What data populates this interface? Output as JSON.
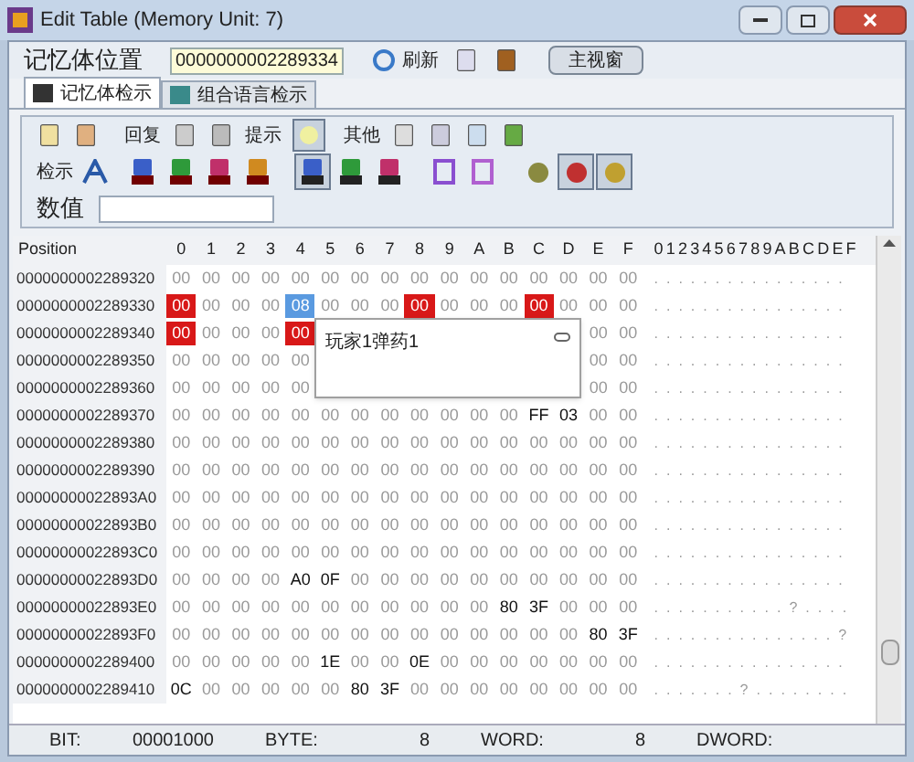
{
  "window": {
    "title": "Edit Table (Memory Unit: 7)"
  },
  "address_bar": {
    "label": "记忆体位置",
    "value": "0000000002289334",
    "refresh": "刷新",
    "main_button": "主视窗"
  },
  "tabs": [
    {
      "label": "记忆体检示",
      "selected": true
    },
    {
      "label": "组合语言检示",
      "selected": false
    }
  ],
  "toolbar": {
    "restore": "回复",
    "hint": "提示",
    "hint_pressed": true,
    "other": "其他",
    "view": "检示",
    "view_buttons": [
      {
        "kind": "dec",
        "color": "#3a5fc8",
        "pressed": false
      },
      {
        "kind": "dec",
        "color": "#2e9a3a",
        "pressed": false
      },
      {
        "kind": "dec",
        "color": "#c0306a",
        "pressed": false
      },
      {
        "kind": "dec",
        "color": "#d08a20",
        "pressed": false
      },
      {
        "kind": "hex",
        "color": "#3a5fc8",
        "pressed": true
      },
      {
        "kind": "hex",
        "color": "#2e9a3a",
        "pressed": false
      },
      {
        "kind": "hex",
        "color": "#c0306a",
        "pressed": false
      },
      {
        "kind": "page",
        "color": "#8a4fd0",
        "pressed": false
      },
      {
        "kind": "page",
        "color": "#b060d0",
        "pressed": false
      },
      {
        "kind": "ball",
        "color": "#8a8a40",
        "pressed": false
      },
      {
        "kind": "ball",
        "color": "#c03030",
        "pressed": true
      },
      {
        "kind": "ball",
        "color": "#c0a030",
        "pressed": true
      }
    ],
    "value_label": "数值"
  },
  "table": {
    "position_header": "Position",
    "columns": [
      "0",
      "1",
      "2",
      "3",
      "4",
      "5",
      "6",
      "7",
      "8",
      "9",
      "A",
      "B",
      "C",
      "D",
      "E",
      "F"
    ],
    "ascii_header": "0123456789ABCDEF",
    "rows": [
      {
        "address": "0000000002289320",
        "bytes": [
          "00",
          "00",
          "00",
          "00",
          "00",
          "00",
          "00",
          "00",
          "00",
          "00",
          "00",
          "00",
          "00",
          "00",
          "00",
          "00"
        ],
        "ascii": "................"
      },
      {
        "address": "0000000002289330",
        "bytes": [
          {
            "value": "00",
            "kind": "breakpoint"
          },
          "00",
          "00",
          "00",
          {
            "value": "08",
            "kind": "cursor"
          },
          "00",
          "00",
          "00",
          {
            "value": "00",
            "kind": "breakpoint"
          },
          "00",
          "00",
          "00",
          {
            "value": "00",
            "kind": "breakpoint"
          },
          "00",
          "00",
          "00"
        ],
        "ascii": "................"
      },
      {
        "address": "0000000002289340",
        "bytes": [
          {
            "value": "00",
            "kind": "breakpoint"
          },
          "00",
          "00",
          "00",
          {
            "value": "00",
            "kind": "breakpoint"
          }
        ],
        "bytes_after_popup": [
          "00",
          "00"
        ],
        "ascii": "................"
      },
      {
        "address": "0000000002289350",
        "bytes": [
          "00",
          "00",
          "00",
          "00",
          "00"
        ],
        "bytes_after_popup": [
          "00",
          "00"
        ],
        "ascii": "................"
      },
      {
        "address": "0000000002289360",
        "bytes": [
          "00",
          "00",
          "00",
          "00",
          "00"
        ],
        "bytes_after_popup": [
          "00",
          "00"
        ],
        "ascii": "................"
      },
      {
        "address": "0000000002289370",
        "bytes": [
          "00",
          "00",
          "00",
          "00",
          "00",
          "00",
          "00",
          "00",
          "00",
          "00",
          "00",
          "00",
          {
            "value": "FF",
            "kind": "changed"
          },
          {
            "value": "03",
            "kind": "changed"
          },
          "00",
          "00"
        ],
        "ascii": "................"
      },
      {
        "address": "0000000002289380",
        "bytes": [
          "00",
          "00",
          "00",
          "00",
          "00",
          "00",
          "00",
          "00",
          "00",
          "00",
          "00",
          "00",
          "00",
          "00",
          "00",
          "00"
        ],
        "ascii": "................"
      },
      {
        "address": "0000000002289390",
        "bytes": [
          "00",
          "00",
          "00",
          "00",
          "00",
          "00",
          "00",
          "00",
          "00",
          "00",
          "00",
          "00",
          "00",
          "00",
          "00",
          "00"
        ],
        "ascii": "................"
      },
      {
        "address": "00000000022893A0",
        "bytes": [
          "00",
          "00",
          "00",
          "00",
          "00",
          "00",
          "00",
          "00",
          "00",
          "00",
          "00",
          "00",
          "00",
          "00",
          "00",
          "00"
        ],
        "ascii": "................"
      },
      {
        "address": "00000000022893B0",
        "bytes": [
          "00",
          "00",
          "00",
          "00",
          "00",
          "00",
          "00",
          "00",
          "00",
          "00",
          "00",
          "00",
          "00",
          "00",
          "00",
          "00"
        ],
        "ascii": "................"
      },
      {
        "address": "00000000022893C0",
        "bytes": [
          "00",
          "00",
          "00",
          "00",
          "00",
          "00",
          "00",
          "00",
          "00",
          "00",
          "00",
          "00",
          "00",
          "00",
          "00",
          "00"
        ],
        "ascii": "................"
      },
      {
        "address": "00000000022893D0",
        "bytes": [
          "00",
          "00",
          "00",
          "00",
          {
            "value": "A0",
            "kind": "changed"
          },
          {
            "value": "0F",
            "kind": "changed"
          },
          "00",
          "00",
          "00",
          "00",
          "00",
          "00",
          "00",
          "00",
          "00",
          "00"
        ],
        "ascii": "................"
      },
      {
        "address": "00000000022893E0",
        "bytes": [
          "00",
          "00",
          "00",
          "00",
          "00",
          "00",
          "00",
          "00",
          "00",
          "00",
          "00",
          {
            "value": "80",
            "kind": "changed"
          },
          {
            "value": "3F",
            "kind": "changed"
          },
          "00",
          "00",
          "00"
        ],
        "ascii": "...........?...."
      },
      {
        "address": "00000000022893F0",
        "bytes": [
          "00",
          "00",
          "00",
          "00",
          "00",
          "00",
          "00",
          "00",
          "00",
          "00",
          "00",
          "00",
          "00",
          "00",
          {
            "value": "80",
            "kind": "changed"
          },
          {
            "value": "3F",
            "kind": "changed"
          }
        ],
        "ascii": "...............?"
      },
      {
        "address": "0000000002289400",
        "bytes": [
          "00",
          "00",
          "00",
          "00",
          "00",
          {
            "value": "1E",
            "kind": "changed"
          },
          "00",
          "00",
          {
            "value": "0E",
            "kind": "changed"
          },
          "00",
          "00",
          "00",
          "00",
          "00",
          "00",
          "00"
        ],
        "ascii": "................"
      },
      {
        "address": "0000000002289410",
        "bytes": [
          {
            "value": "0C",
            "kind": "changed"
          },
          "00",
          "00",
          "00",
          "00",
          "00",
          {
            "value": "80",
            "kind": "changed"
          },
          {
            "value": "3F",
            "kind": "changed"
          },
          "00",
          "00",
          "00",
          "00",
          "00",
          "00",
          "00",
          "00"
        ],
        "ascii": ".......?........"
      }
    ],
    "popup": {
      "text": "玩家1弹药1"
    }
  },
  "status_bar": [
    {
      "label": "BIT:",
      "value": "00001000"
    },
    {
      "label": "BYTE:",
      "value": "8"
    },
    {
      "label": "WORD:",
      "value": "8"
    },
    {
      "label": "DWORD:"
    }
  ]
}
